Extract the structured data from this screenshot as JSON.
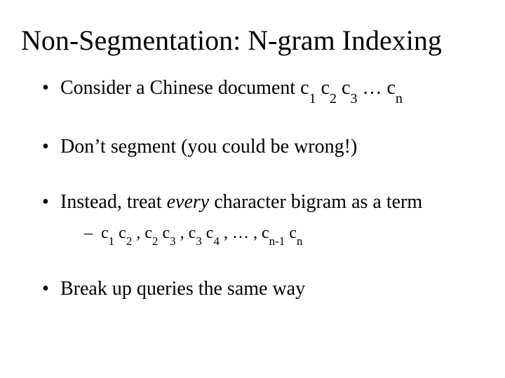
{
  "title": "Non-Segmentation: N-gram Indexing",
  "bullets": {
    "b1_pre": "Consider a Chinese document   c",
    "b1_s1": "1",
    "b1_c2": " c",
    "b1_s2": "2",
    "b1_c3": " c",
    "b1_s3": "3",
    "b1_dots": " … c",
    "b1_sn": "n",
    "b2": "Don’t segment (you could be wrong!)",
    "b3_pre": "Instead, treat ",
    "b3_em": "every",
    "b3_post": " character bigram as a term",
    "sub_lead": " ",
    "sub_c1a": "c",
    "sub_s1a": "1",
    "sub_c2a": " c",
    "sub_s2a": "2",
    "sub_sep1": " ,  c",
    "sub_s2b": "2",
    "sub_c3a": " c",
    "sub_s3a": "3",
    "sub_sep2": " ,  c",
    "sub_s3b": "3",
    "sub_c4a": " c",
    "sub_s4a": "4",
    "sub_sep3": " ,  …    ,  c",
    "sub_snm1": "n-1",
    "sub_cn": " c",
    "sub_sn": "n",
    "b4": "Break up queries the same way"
  }
}
